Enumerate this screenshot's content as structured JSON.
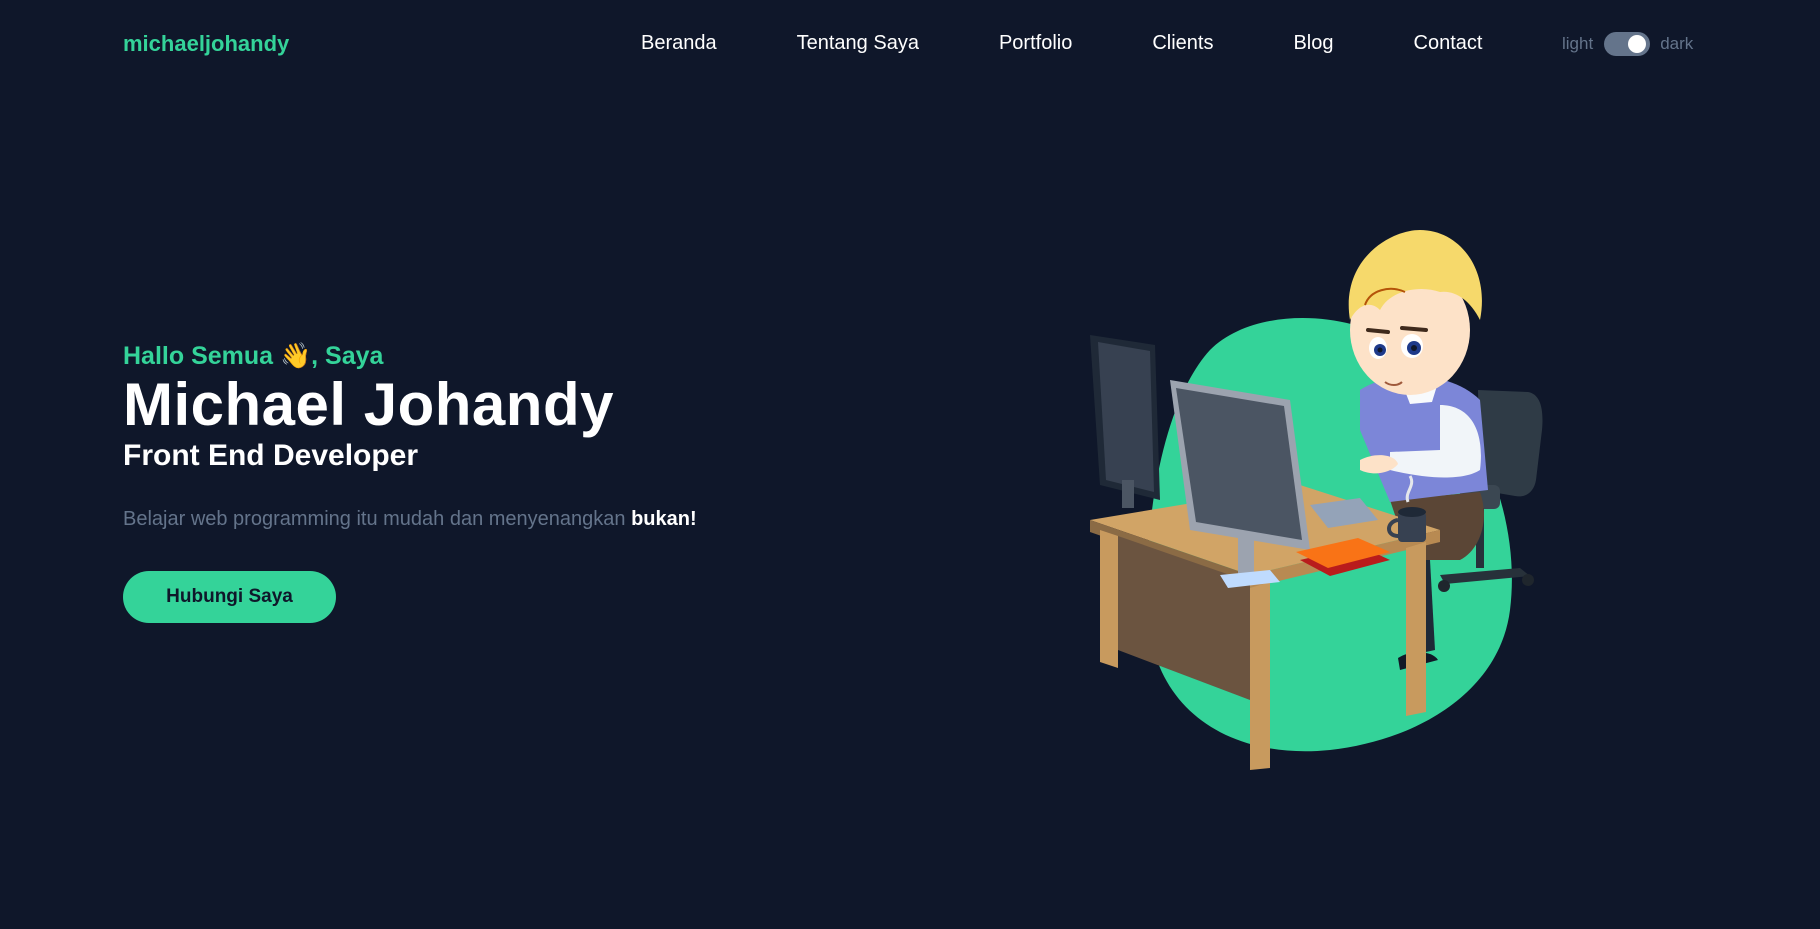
{
  "header": {
    "logo": "michaeljohandy",
    "nav": [
      "Beranda",
      "Tentang Saya",
      "Portfolio",
      "Clients",
      "Blog",
      "Contact"
    ],
    "theme_toggle": {
      "light_label": "light",
      "dark_label": "dark",
      "state": "dark"
    }
  },
  "hero": {
    "greeting": "Hallo Semua 👋, Saya",
    "name": "Michael Johandy",
    "role": "Front End Developer",
    "tagline": "Belajar web programming itu mudah dan menyenangkan ",
    "tagline_emphasis": "bukan!",
    "cta_label": "Hubungi Saya"
  },
  "colors": {
    "background": "#0f172a",
    "accent": "#34d399",
    "muted": "#64748b",
    "text": "#ffffff"
  }
}
